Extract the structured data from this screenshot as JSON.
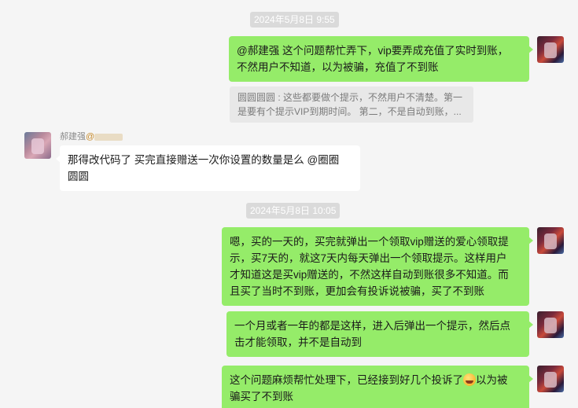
{
  "timestamps": [
    "2024年5月8日 9:55",
    "2024年5月8日 10:05"
  ],
  "messages": [
    {
      "text_lines": [
        "@郝建强 这个问题帮忙弄下，vip要弄成充值了实时到账，",
        "不然用户不知道，以为被骗，充值了不到账"
      ]
    },
    {
      "quote_lines": [
        "圆圆圆圆 : 这些都要做个提示，不然用户不清楚。第一",
        "是要有个提示VIP到期时间。 第二，不是自动到账，..."
      ]
    },
    {
      "sender_name": "郝建强",
      "sender_at": "@",
      "text_lines": [
        "那得改代码了  买完直接赠送一次你设置的数量是么 @圈圈",
        "圆圆"
      ]
    },
    {
      "text_lines": [
        "嗯，买的一天的，买完就弹出一个领取vip赠送的爱心领取提",
        "示，买7天的，就这7天内每天弹出一个领取提示。这样用户",
        "才知道这是买vip赠送的，不然这样自动到账很多不知道。而",
        "且买了当时不到账，更加会有投诉说被骗，买了不到账"
      ]
    },
    {
      "text_lines": [
        "一个月或者一年的都是这样，进入后弹出一个提示，然后点",
        "击才能领取，并不是自动到"
      ]
    },
    {
      "text_a": "这个问题麻烦帮忙处理下，已经接到好几个投诉了",
      "text_b": "以为被",
      "text_line2": "骗买了不到账",
      "emoji": "face-with-tears-of-joy"
    }
  ]
}
